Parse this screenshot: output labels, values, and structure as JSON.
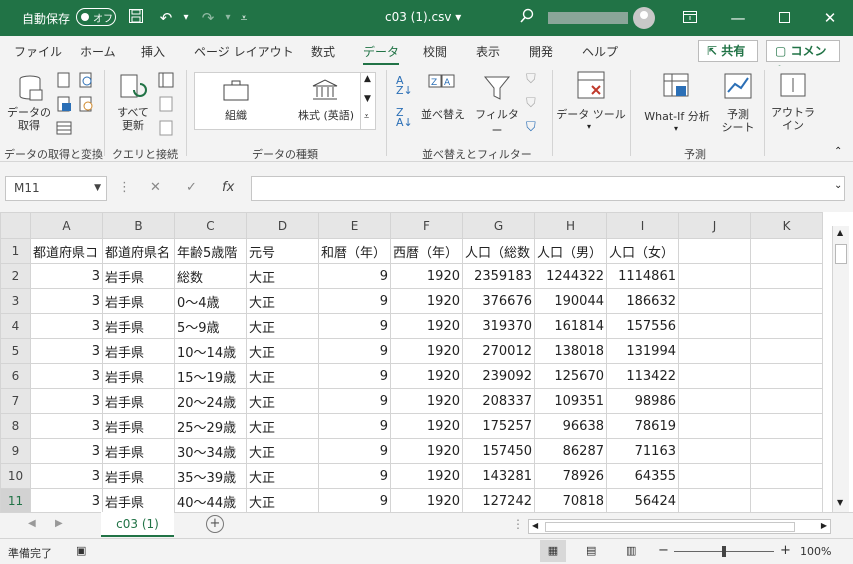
{
  "titlebar": {
    "autosave_label": "自動保存",
    "autosave_state": "オフ",
    "filename": "c03 (1).csv",
    "filename_arrow": "▾"
  },
  "tabs": [
    {
      "label": "ファイル"
    },
    {
      "label": "ホーム"
    },
    {
      "label": "挿入"
    },
    {
      "label": "ページ レイアウト"
    },
    {
      "label": "数式"
    },
    {
      "label": "データ"
    },
    {
      "label": "校閲"
    },
    {
      "label": "表示"
    },
    {
      "label": "開発"
    },
    {
      "label": "ヘルプ"
    }
  ],
  "share_label": "共有",
  "comment_label": "コメント",
  "ribbon": {
    "get_data": "データの\n取得",
    "refresh_all": "すべて\n更新",
    "gallery_item1": "組織",
    "gallery_item2": "株式 (英語)",
    "sort": "並べ替え",
    "filter": "フィルター",
    "data_tools": "データ ツール",
    "whatif": "What-If 分析",
    "forecast_sheet": "予測\nシート",
    "outline": "アウトラ\nイン",
    "groups": {
      "get_transform": "データの取得と変換",
      "queries": "クエリと接続",
      "data_types": "データの種類",
      "sort_filter": "並べ替えとフィルター",
      "forecast": "予測"
    }
  },
  "formula_bar": {
    "name_box": "M11",
    "fx": "fx",
    "content": ""
  },
  "grid": {
    "columns": [
      "A",
      "B",
      "C",
      "D",
      "E",
      "F",
      "G",
      "H",
      "I",
      "J",
      "K"
    ],
    "rows": [
      {
        "n": "1",
        "cells": [
          "都道府県コ",
          "都道府県名",
          "年齢5歳階",
          "元号",
          "和暦（年）",
          "西暦（年）",
          "人口（総数",
          "人口（男）",
          "人口（女）",
          "",
          ""
        ]
      },
      {
        "n": "2",
        "cells": [
          "3",
          "岩手県",
          "総数",
          "大正",
          "9",
          "1920",
          "2359183",
          "1244322",
          "1114861",
          "",
          ""
        ]
      },
      {
        "n": "3",
        "cells": [
          "3",
          "岩手県",
          "0～4歳",
          "大正",
          "9",
          "1920",
          "376676",
          "190044",
          "186632",
          "",
          ""
        ]
      },
      {
        "n": "4",
        "cells": [
          "3",
          "岩手県",
          "5～9歳",
          "大正",
          "9",
          "1920",
          "319370",
          "161814",
          "157556",
          "",
          ""
        ]
      },
      {
        "n": "5",
        "cells": [
          "3",
          "岩手県",
          "10～14歳",
          "大正",
          "9",
          "1920",
          "270012",
          "138018",
          "131994",
          "",
          ""
        ]
      },
      {
        "n": "6",
        "cells": [
          "3",
          "岩手県",
          "15～19歳",
          "大正",
          "9",
          "1920",
          "239092",
          "125670",
          "113422",
          "",
          ""
        ]
      },
      {
        "n": "7",
        "cells": [
          "3",
          "岩手県",
          "20～24歳",
          "大正",
          "9",
          "1920",
          "208337",
          "109351",
          "98986",
          "",
          ""
        ]
      },
      {
        "n": "8",
        "cells": [
          "3",
          "岩手県",
          "25～29歳",
          "大正",
          "9",
          "1920",
          "175257",
          "96638",
          "78619",
          "",
          ""
        ]
      },
      {
        "n": "9",
        "cells": [
          "3",
          "岩手県",
          "30～34歳",
          "大正",
          "9",
          "1920",
          "157450",
          "86287",
          "71163",
          "",
          ""
        ]
      },
      {
        "n": "10",
        "cells": [
          "3",
          "岩手県",
          "35～39歳",
          "大正",
          "9",
          "1920",
          "143281",
          "78926",
          "64355",
          "",
          ""
        ]
      },
      {
        "n": "11",
        "cells": [
          "3",
          "岩手県",
          "40～44歳",
          "大正",
          "9",
          "1920",
          "127242",
          "70818",
          "56424",
          "",
          ""
        ]
      }
    ]
  },
  "sheet_tab": "c03 (1)",
  "status": {
    "ready": "準備完了",
    "zoom": "100%"
  }
}
